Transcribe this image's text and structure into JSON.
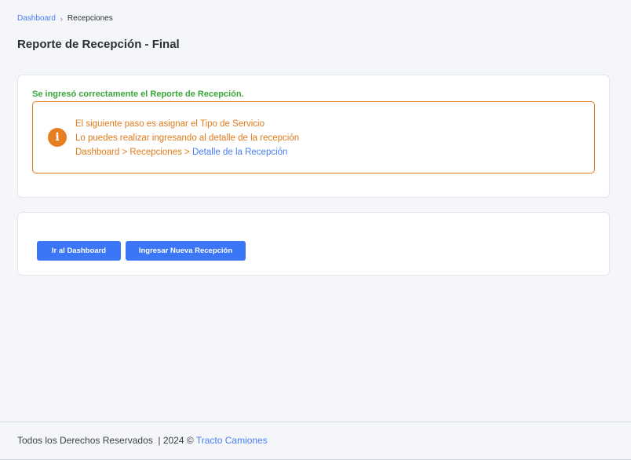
{
  "breadcrumb": {
    "items": [
      {
        "label": "Dashboard"
      },
      {
        "label": "Recepciones"
      }
    ],
    "separator": "›"
  },
  "page": {
    "title": "Reporte de Recepción - Final"
  },
  "success": {
    "message": "Se ingresó correctamente el Reporte de Recepción."
  },
  "alert": {
    "icon": "info-icon",
    "icon_glyph": "i",
    "line1": "El siguiente paso es asignar el Tipo de Servicio",
    "line2": "Lo puedes realizar ingresando al detalle de la recepción",
    "path_prefix": "Dashboard > Recepciones > ",
    "path_link": "Detalle de la Recepción"
  },
  "actions": {
    "dashboard_label": "Ir al Dashboard",
    "new_label": "Ingresar Nueva Recepción"
  },
  "footer": {
    "text": "Todos los Derechos Reservados  | 2024 © ",
    "brand": "Tracto Camiones"
  },
  "colors": {
    "accent": "#3b76f6",
    "success": "#3aa63a",
    "warning": "#e07a1a",
    "link": "#4a7cf6"
  }
}
